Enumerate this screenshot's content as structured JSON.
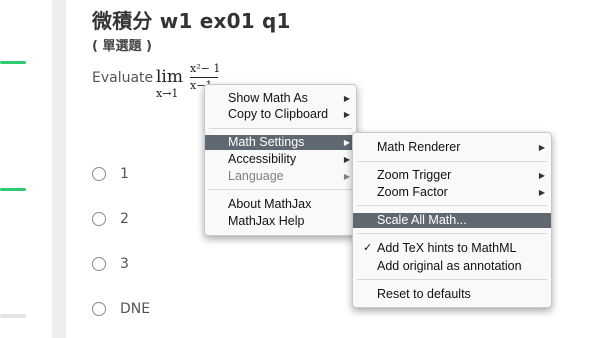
{
  "question": {
    "title": "微積分 w1 ex01 q1",
    "type": "( 單選題 )",
    "prompt": "Evaluate",
    "math": {
      "lim": "lim",
      "sub": "x→1",
      "numerator": "x²− 1",
      "denominator": "x−1"
    }
  },
  "options": [
    {
      "label": "1"
    },
    {
      "label": "2"
    },
    {
      "label": "3"
    },
    {
      "label": "DNE"
    }
  ],
  "context_menu": {
    "items": [
      {
        "label": "Show Math As",
        "submenu": true
      },
      {
        "label": "Copy to Clipboard",
        "submenu": true
      },
      {
        "label": "Math Settings",
        "submenu": true,
        "active": true
      },
      {
        "label": "Accessibility",
        "submenu": true
      },
      {
        "label": "Language",
        "submenu": true,
        "disabled": true
      },
      {
        "label": "About MathJax"
      },
      {
        "label": "MathJax Help"
      }
    ]
  },
  "settings_submenu": {
    "items": [
      {
        "label": "Math Renderer",
        "submenu": true
      },
      {
        "label": "Zoom Trigger",
        "submenu": true
      },
      {
        "label": "Zoom Factor",
        "submenu": true
      },
      {
        "label": "Scale All Math...",
        "active": true
      },
      {
        "label": "Add TeX hints to MathML",
        "checked": true
      },
      {
        "label": "Add original as annotation"
      },
      {
        "label": "Reset to defaults"
      }
    ]
  },
  "icons": {
    "submenu_arrow": "triangle-right-icon",
    "checkmark": "checkmark-icon",
    "radio": "radio-unchecked-icon"
  },
  "colors": {
    "accent_green": "#2ecc71",
    "menu_highlight": "#606872",
    "left_divider": "#eeeeee",
    "light_mark": "#e4e4e4"
  }
}
